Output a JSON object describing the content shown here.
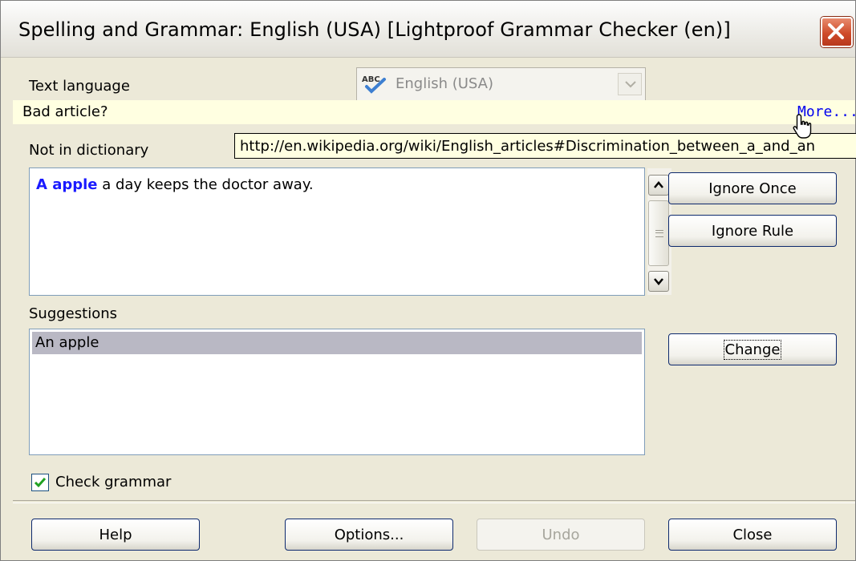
{
  "window": {
    "title": "Spelling and Grammar: English (USA) [Lightproof Grammar Checker (en)]"
  },
  "language": {
    "label": "Text language",
    "value": "English (USA)"
  },
  "info_bar": {
    "message": "Bad article?",
    "link": "More..."
  },
  "tooltip": "http://en.wikipedia.org/wiki/English_articles#Discrimination_between_a_and_an",
  "not_in_dictionary": {
    "label": "Not in dictionary",
    "error_text": "A apple",
    "rest_text": " a day keeps the doctor away."
  },
  "suggestions": {
    "label": "Suggestions",
    "items": [
      "An apple"
    ]
  },
  "buttons": {
    "ignore_once": "Ignore Once",
    "ignore_rule": "Ignore Rule",
    "change": "Change",
    "help": "Help",
    "options": "Options...",
    "undo": "Undo",
    "close": "Close"
  },
  "check_grammar": {
    "label": "Check grammar",
    "checked": true
  },
  "colors": {
    "error_text": "#1a1aff",
    "info_bar_bg": "#ffffe1",
    "dialog_bg": "#ece9d8",
    "close_button": "#cf4b2a"
  }
}
